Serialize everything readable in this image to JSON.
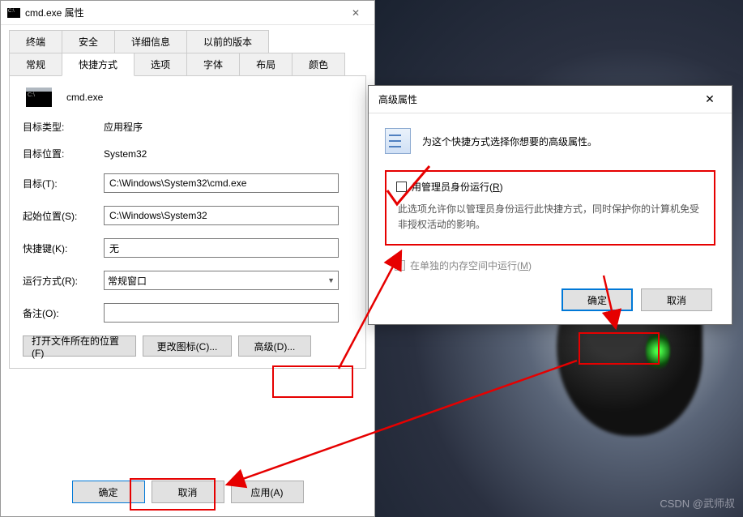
{
  "props": {
    "title": "cmd.exe 属性",
    "tabs_row1": [
      "终端",
      "安全",
      "详细信息",
      "以前的版本"
    ],
    "tabs_row2": [
      "常规",
      "快捷方式",
      "选项",
      "字体",
      "布局",
      "颜色"
    ],
    "active_tab": "快捷方式",
    "shortcut_name": "cmd.exe",
    "fields": {
      "type_label": "目标类型:",
      "type_value": "应用程序",
      "loc_label": "目标位置:",
      "loc_value": "System32",
      "target_label": "目标(T):",
      "target_value": "C:\\Windows\\System32\\cmd.exe",
      "start_label": "起始位置(S):",
      "start_value": "C:\\Windows\\System32",
      "hotkey_label": "快捷键(K):",
      "hotkey_value": "无",
      "run_label": "运行方式(R):",
      "run_value": "常规窗口",
      "comment_label": "备注(O):",
      "comment_value": ""
    },
    "buttons": {
      "open_location": "打开文件所在的位置(F)",
      "change_icon": "更改图标(C)...",
      "advanced": "高级(D)..."
    },
    "bottom": {
      "ok": "确定",
      "cancel": "取消",
      "apply": "应用(A)"
    }
  },
  "adv": {
    "title": "高级属性",
    "header_text": "为这个快捷方式选择你想要的高级属性。",
    "admin_label": "用管理员身份运行(R)",
    "admin_desc": "此选项允许你以管理员身份运行此快捷方式，同时保护你的计算机免受非授权活动的影响。",
    "sep_mem_label": "在单独的内存空间中运行(M)",
    "ok": "确定",
    "cancel": "取消"
  },
  "watermark": "CSDN @武师叔"
}
